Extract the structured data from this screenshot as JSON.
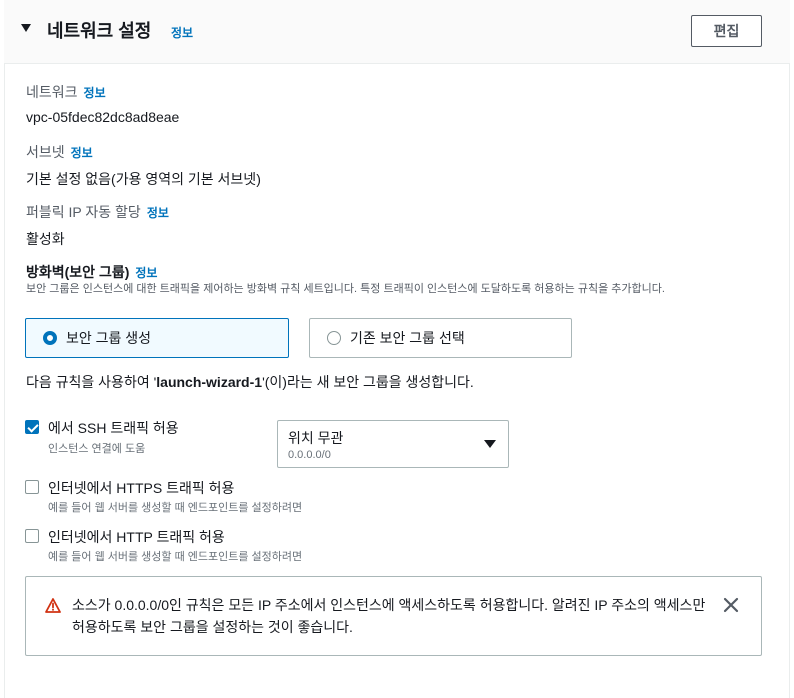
{
  "header": {
    "title": "네트워크 설정",
    "info": "정보",
    "edit_label": "편집"
  },
  "network": {
    "label": "네트워크",
    "info": "정보",
    "value": "vpc-05fdec82dc8ad8eae"
  },
  "subnet": {
    "label": "서브넷",
    "info": "정보",
    "value": "기본 설정 없음(가용 영역의 기본 서브넷)"
  },
  "public_ip": {
    "label": "퍼블릭 IP 자동 할당",
    "info": "정보",
    "value": "활성화"
  },
  "firewall": {
    "title": "방화벽(보안 그룹)",
    "info": "정보",
    "description": "보안 그룹은 인스턴스에 대한 트래픽을 제어하는 방화벽 규칙 세트입니다. 특정 트래픽이 인스턴스에 도달하도록 허용하는 규칙을 추가합니다.",
    "options": [
      {
        "label": "보안 그룹 생성",
        "selected": true
      },
      {
        "label": "기존 보안 그룹 선택",
        "selected": false
      }
    ],
    "create_text_pre": "다음 규칙을 사용하여 '",
    "create_text_name": "launch-wizard-1",
    "create_text_post": "'(이)라는 새 보안 그룹을 생성합니다."
  },
  "rules": [
    {
      "label": "에서 SSH 트래픽 허용",
      "desc": "인스턴스 연결에 도움",
      "checked": true
    },
    {
      "label": "인터넷에서 HTTPS 트래픽 허용",
      "desc": "예를 들어 웹 서버를 생성할 때 엔드포인트를 설정하려면",
      "checked": false
    },
    {
      "label": "인터넷에서 HTTP 트래픽 허용",
      "desc": "예를 들어 웹 서버를 생성할 때 엔드포인트를 설정하려면",
      "checked": false
    }
  ],
  "ssh_source": {
    "value": "위치 무관",
    "sub": "0.0.0.0/0"
  },
  "alert": {
    "text": "소스가 0.0.0.0/0인 규칙은 모든 IP 주소에서 인스턴스에 액세스하도록 허용합니다. 알려진 IP 주소의 액세스만 허용하도록 보안 그룹을 설정하는 것이 좋습니다."
  },
  "colors": {
    "accent": "#0073bb",
    "warning": "#d13212",
    "border": "#aab7b8"
  }
}
